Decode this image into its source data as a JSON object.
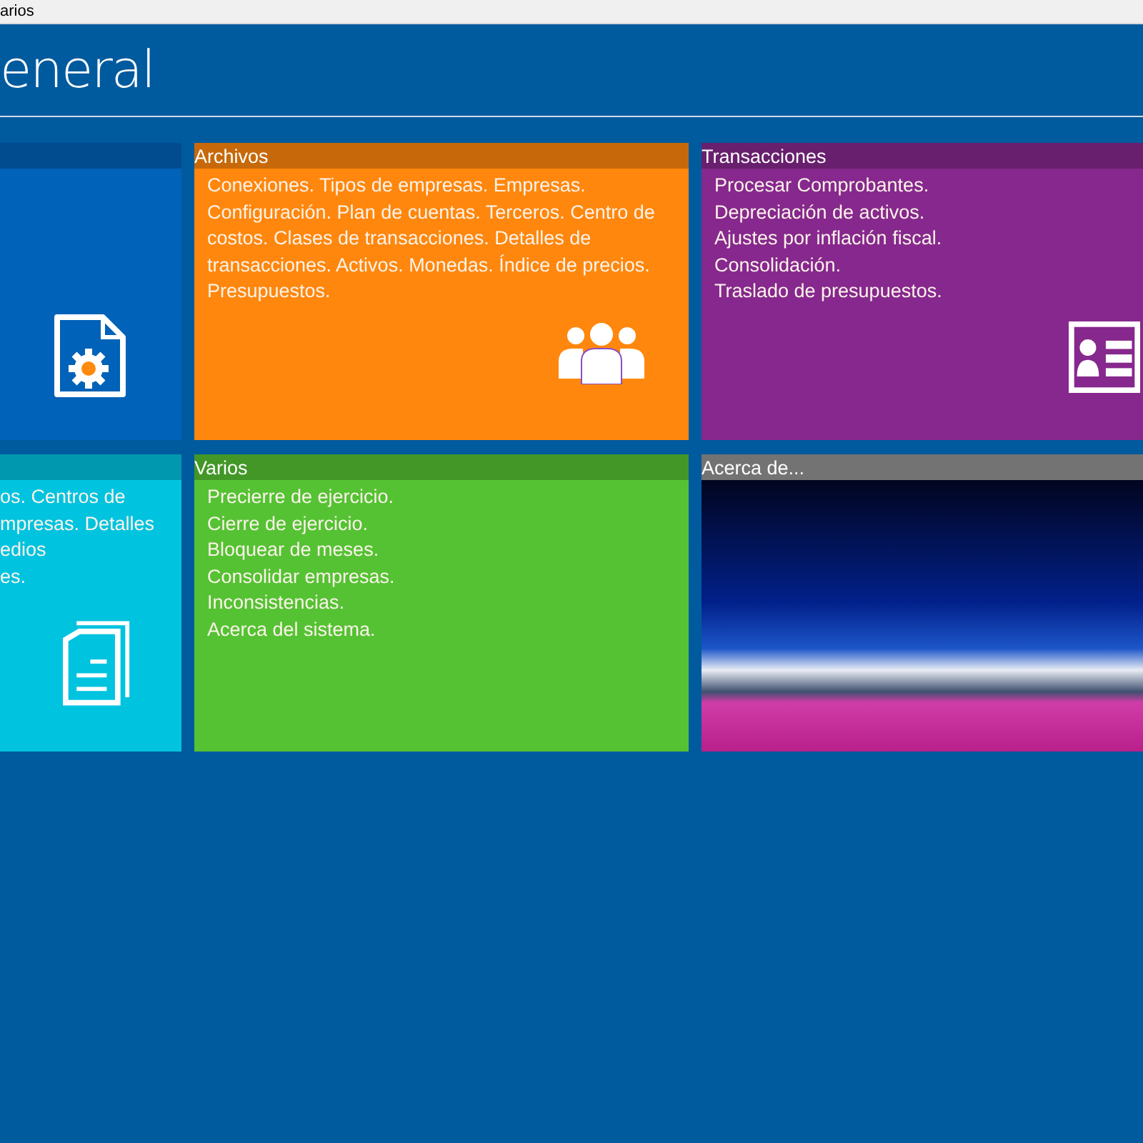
{
  "window": {
    "title": "arios"
  },
  "page_title": "eneral",
  "tiles": [
    {
      "kind": "menu",
      "color": "#0062b8"
    },
    {
      "kind": "menu",
      "title": "Archivos",
      "color": "#ff870d",
      "items": [
        "Conexiones. Tipos de empresas. Empresas. Configuración. Plan de cuentas. Terceros. Centro de costos. Clases de transacciones. Detalles de transacciones. Activos. Monedas. Índice de precios. Presupuestos."
      ]
    },
    {
      "kind": "menu",
      "title": "Transacciones",
      "color": "#86288d",
      "items": [
        "Procesar Comprobantes.",
        "Depreciación de activos.",
        "Ajustes por inflación fiscal.",
        "Consolidación.",
        "Traslado de presupuestos."
      ]
    },
    {
      "kind": "menu",
      "color": "#00c3df",
      "items": [
        "os. Centros de",
        "mpresas. Detalles",
        "edios",
        "es."
      ]
    },
    {
      "kind": "menu",
      "title": "Varios",
      "color": "#55c233",
      "items": [
        "Precierre de ejercicio.",
        "Cierre de ejercicio.",
        "Bloquear de meses.",
        "Consolidar empresas.",
        "Inconsistencias.",
        "Acerca del sistema."
      ]
    },
    {
      "kind": "photo",
      "title": "Acerca de...",
      "color": "#737373"
    }
  ]
}
